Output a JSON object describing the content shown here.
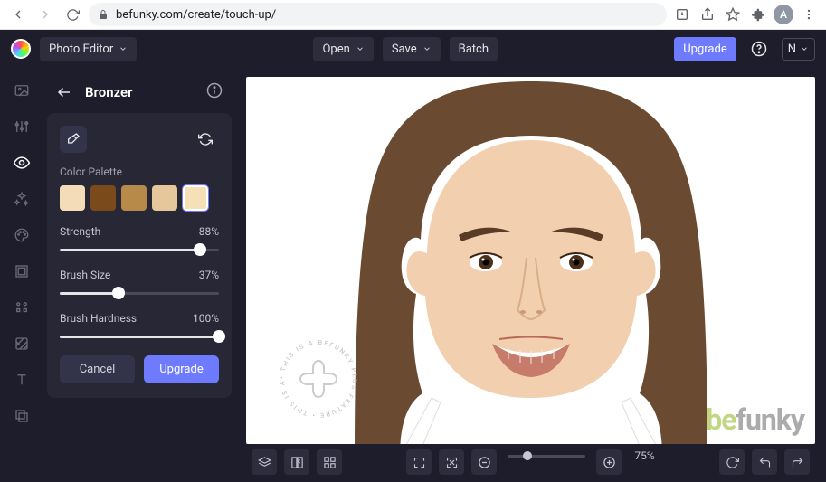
{
  "browser": {
    "url": "befunky.com/create/touch-up/",
    "avatar_initial": "A"
  },
  "app_bar": {
    "editor_label": "Photo Editor",
    "open": "Open",
    "save": "Save",
    "batch": "Batch",
    "upgrade": "Upgrade",
    "user_initial": "N"
  },
  "panel": {
    "title": "Bronzer",
    "color_palette_label": "Color Palette",
    "swatches": [
      "#f3dcb7",
      "#7a4a1a",
      "#b88a4a",
      "#e6c79c",
      "#f6e0b8"
    ],
    "selected_swatch": 4,
    "sliders": {
      "strength": {
        "label": "Strength",
        "value": 88,
        "display": "88%"
      },
      "brush_size": {
        "label": "Brush Size",
        "value": 37,
        "display": "37%"
      },
      "brush_hardness": {
        "label": "Brush Hardness",
        "value": 100,
        "display": "100%"
      }
    },
    "cancel": "Cancel",
    "upgrade": "Upgrade"
  },
  "canvas": {
    "watermark_be": "be",
    "watermark_funky": "funky",
    "zoom_pct": "75%"
  },
  "rail_icons": [
    "image",
    "adjust",
    "eye",
    "sparkle",
    "palette",
    "crop",
    "grid",
    "texture",
    "text",
    "layers"
  ]
}
